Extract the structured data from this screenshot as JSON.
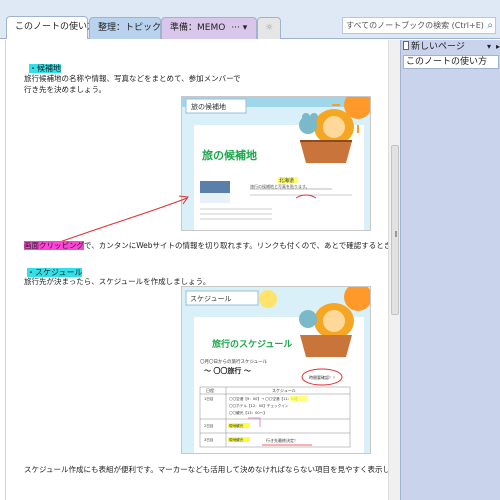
{
  "tabs": {
    "active": "このノートの使い方",
    "t2": "整理：トピック",
    "t3": "準備：MEMO",
    "t3_more": "···",
    "t3_caret": "▾",
    "t4": "☼"
  },
  "search": {
    "placeholder": "すべてのノートブックの検索 (Ctrl+E)",
    "icon": "⌕"
  },
  "rightpanel": {
    "new_page": "新しいページ",
    "caret": "▾",
    "arrow": "▸",
    "pages": [
      "このノートの使い方"
    ]
  },
  "content": {
    "section1_heading": "・候補地",
    "section1_line1": "旅行候補地の名称や情報、写真などをまとめて、参加メンバーで",
    "section1_line2": "行き先を決めましょう。",
    "clip_label": "画面クリッピング",
    "clip_text": "で、カンタンにWebサイトの情報を切り取れます。リンクも付くので、あとで確認するときも便利です。",
    "section2_heading": "・スケジュール",
    "section2_line1": "旅行先が決まったら、スケジュールを作成しましょう。",
    "footer_line": "スケジュール作成にも表組が便利です。マーカーなども活用して決めなければならない項目を見やすく表示しましょう。"
  },
  "shot1": {
    "tab_title": "旅の候補地",
    "big_title": "旅の候補地",
    "place_label": "北海道",
    "desc": "旅行の候補地と写真を貼ります。"
  },
  "shot2": {
    "tab_title": "スケジュール",
    "big_title": "旅行のスケジュール",
    "sub": "〇月〇日からの旅行スケジュール",
    "trip": "～ 〇〇旅行 ～",
    "bubble": "時間要確認！！",
    "col_day": "日程",
    "col_sched": "スケジュール",
    "rows": [
      [
        "1日目",
        "〇〇空港【9：00】→ 〇〇空港【11：00】"
      ],
      [
        "",
        "〇〇ホテル【12：00】チェックイン"
      ],
      [
        "",
        "〇〇観光【13：00～】"
      ],
      [
        "2日目",
        "現地観光"
      ],
      [
        "3日目",
        "現地観光"
      ]
    ],
    "note": "行き先最終決定！"
  },
  "colors": {
    "cyan_marker": "#33e0e8",
    "magenta_marker": "#ff44d8",
    "annotation": "#e03030"
  }
}
